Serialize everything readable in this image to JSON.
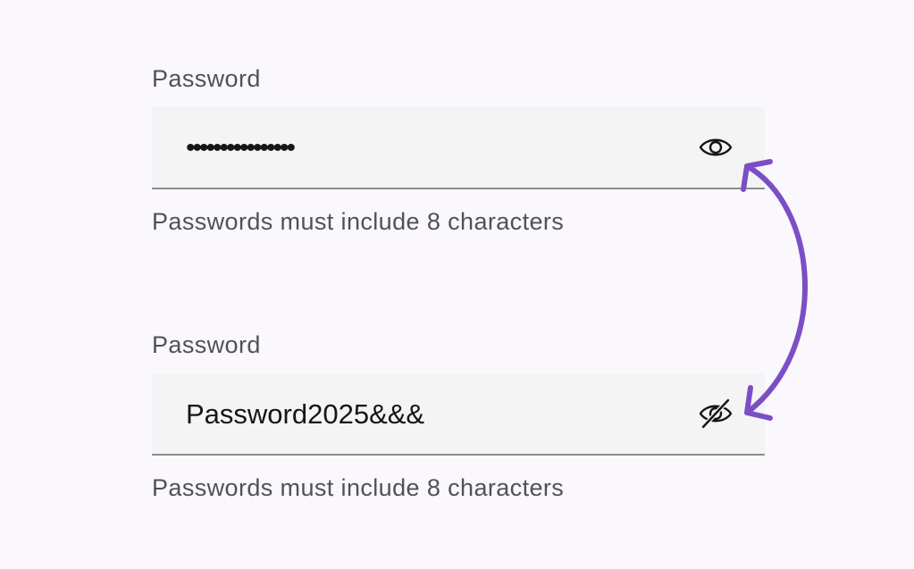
{
  "fields": [
    {
      "label": "Password",
      "value": "••••••••••••••••",
      "helper": "Passwords must include 8 characters",
      "toggle_icon": "eye-icon",
      "state": "hidden"
    },
    {
      "label": "Password",
      "value": "Password2025&&&",
      "helper": "Passwords must include 8 characters",
      "toggle_icon": "eye-off-icon",
      "state": "visible"
    }
  ],
  "colors": {
    "background": "#faf7fd",
    "field_background": "#f4f4f4",
    "field_border": "#8d8d8d",
    "label_text": "#525252",
    "value_text": "#161616",
    "accent_arrow": "#7b4fc4"
  },
  "annotation": {
    "icon": "double-headed-curved-arrow"
  }
}
